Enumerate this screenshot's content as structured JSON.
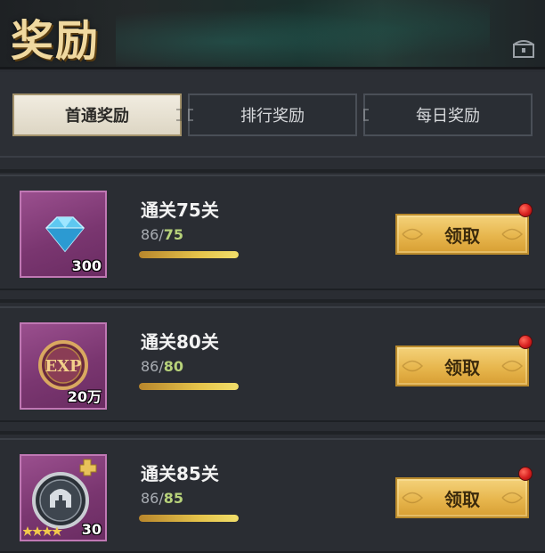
{
  "header": {
    "title": "奖励",
    "chest_icon": "treasure-chest-icon"
  },
  "tabs": [
    {
      "label": "首通奖励",
      "active": true
    },
    {
      "label": "排行奖励",
      "active": false
    },
    {
      "label": "每日奖励",
      "active": false
    }
  ],
  "rewards": [
    {
      "title": "通关75关",
      "current": "86",
      "separator": "/",
      "target": "75",
      "progress": 1.0,
      "item_icon": "diamond-icon",
      "quantity": "300",
      "claim_label": "领取",
      "has_notification": true
    },
    {
      "title": "通关80关",
      "current": "86",
      "separator": "/",
      "target": "80",
      "progress": 1.0,
      "item_icon": "exp-coin-icon",
      "quantity": "20万",
      "claim_label": "领取",
      "has_notification": true
    },
    {
      "title": "通关85关",
      "current": "86",
      "separator": "/",
      "target": "85",
      "progress": 1.0,
      "item_icon": "helmet-badge-icon",
      "quantity": "30",
      "claim_label": "领取",
      "has_notification": true,
      "stars": 4
    }
  ],
  "colors": {
    "accent_gold": "#e7b64d",
    "target_green": "#b7d27a",
    "item_bg_purple": "#8a4280",
    "notification_red": "#d61f1f"
  }
}
